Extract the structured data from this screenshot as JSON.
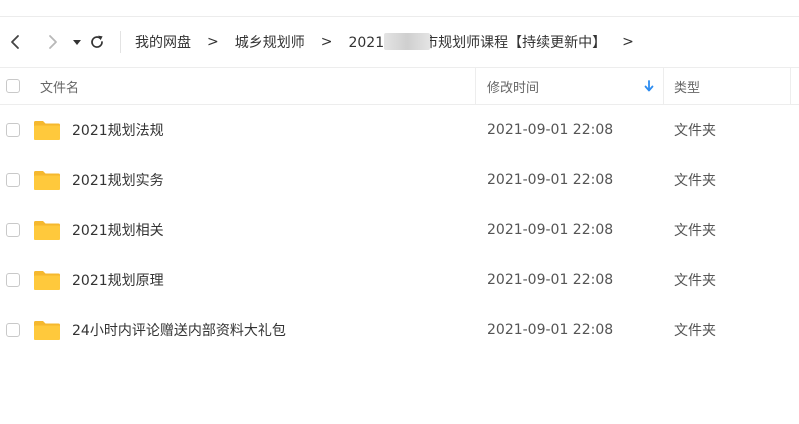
{
  "toolbar": {
    "back_icon": "chevron-left-icon",
    "forward_icon": "chevron-right-icon",
    "history_icon": "caret-down-icon",
    "refresh_icon": "refresh-icon",
    "breadcrumbs": [
      {
        "label": "我的网盘"
      },
      {
        "label": "城乡规划师"
      },
      {
        "label_prefix": "2021",
        "label_suffix": "市规划师课程【持续更新中】"
      }
    ],
    "separator": ">"
  },
  "table": {
    "columns": {
      "name": "文件名",
      "modified": "修改时间",
      "type": "类型"
    },
    "sort_icon": "arrow-down-icon",
    "rows": [
      {
        "name": "2021规划法规",
        "modified": "2021-09-01 22:08",
        "type": "文件夹",
        "icon": "folder-icon"
      },
      {
        "name": "2021规划实务",
        "modified": "2021-09-01 22:08",
        "type": "文件夹",
        "icon": "folder-icon"
      },
      {
        "name": "2021规划相关",
        "modified": "2021-09-01 22:08",
        "type": "文件夹",
        "icon": "folder-icon"
      },
      {
        "name": "2021规划原理",
        "modified": "2021-09-01 22:08",
        "type": "文件夹",
        "icon": "folder-icon"
      },
      {
        "name": "24小时内评论赠送内部资料大礼包",
        "modified": "2021-09-01 22:08",
        "type": "文件夹",
        "icon": "folder-icon"
      }
    ]
  },
  "colors": {
    "folder": "#FFC93C",
    "accent": "#2D8CF0",
    "text": "#333333",
    "muted": "#666666",
    "divider": "#EDEDED"
  }
}
